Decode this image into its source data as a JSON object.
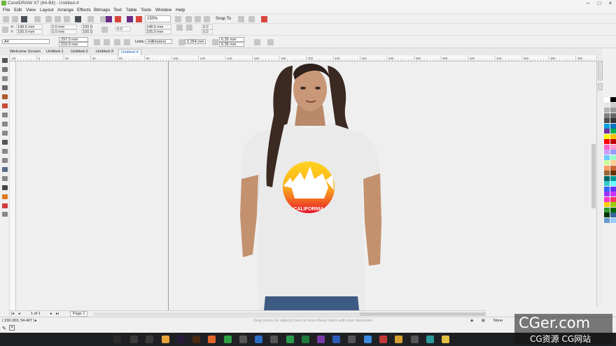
{
  "titlebar": {
    "title": "CorelDRAW X7 (64-Bit) - Untitled-4"
  },
  "menu": [
    "File",
    "Edit",
    "View",
    "Layout",
    "Arrange",
    "Effects",
    "Bitmaps",
    "Text",
    "Table",
    "Tools",
    "Window",
    "Help"
  ],
  "standard_toolbar": {
    "zoom": "150%",
    "snap_to": "Snap To"
  },
  "property_bar": {
    "x_label": "X:",
    "x_value": "148.5 mm",
    "y_label": "Y:",
    "y_value": "105.0 mm",
    "w_value": "0.0 mm",
    "h_value": "0.0 mm",
    "sx_value": "100.0",
    "sy_value": "100.0",
    "rot_value": "0.0",
    "x2_value": "148.5 mm",
    "y2_value": "105.0 mm",
    "a1": "0.0",
    "a2": "0.0"
  },
  "page_bar": {
    "paper": "A4",
    "width": "297.0 mm",
    "height": "210.0 mm",
    "units_label": "Units:",
    "units_value": "millimeters",
    "nudge": "0.254 mm",
    "dup_x": "6.35 mm",
    "dup_y": "6.35 mm"
  },
  "tabs": [
    "Welcome Screen",
    "Untitled-1",
    "Untitled-2",
    "Untitled-3",
    "Untitled-4"
  ],
  "active_tab_index": 4,
  "ruler_labels": [
    "-20",
    "0",
    "20",
    "40",
    "60",
    "80",
    "100",
    "120",
    "140",
    "160",
    "180",
    "200",
    "220",
    "240",
    "260",
    "280",
    "300",
    "320",
    "340",
    "360",
    "380",
    "400"
  ],
  "artwork": {
    "caption": "CALIFORNIA"
  },
  "bottom_nav": {
    "page_count": "1 of 1",
    "page_tab": "Page 1"
  },
  "status": {
    "coords": "( 230.303, 54.407 )",
    "drop_hint": "Drag colors (or objects) here to store these colors with your document",
    "fill_none": "None"
  },
  "watermark": {
    "line1": "CGer.com",
    "line2": "CG资源 CG网站"
  },
  "palette_colors": [
    "#ffffff",
    "#000000",
    "#e6e6e6",
    "#cccccc",
    "#b3b3b3",
    "#999999",
    "#808080",
    "#666666",
    "#4d4d4d",
    "#333333",
    "#00a0e0",
    "#0070c0",
    "#7030a0",
    "#00b050",
    "#ffff00",
    "#ffc000",
    "#ff0000",
    "#c00000",
    "#ff66cc",
    "#ff99cc",
    "#cc99ff",
    "#9999ff",
    "#66ccff",
    "#99ffcc",
    "#ccff99",
    "#ffcc99",
    "#ff9966",
    "#cc6633",
    "#996633",
    "#663300",
    "#006666",
    "#009999",
    "#33cccc",
    "#66ffff",
    "#3366ff",
    "#6633ff",
    "#9933ff",
    "#cc33ff",
    "#ff33cc",
    "#ff3366",
    "#ffcc00",
    "#99cc00",
    "#339933",
    "#006600",
    "#003300",
    "#336699",
    "#6699cc",
    "#99ccff"
  ],
  "colors": {
    "accent": "#1e5bb8",
    "taskbar": "#1f2023"
  }
}
